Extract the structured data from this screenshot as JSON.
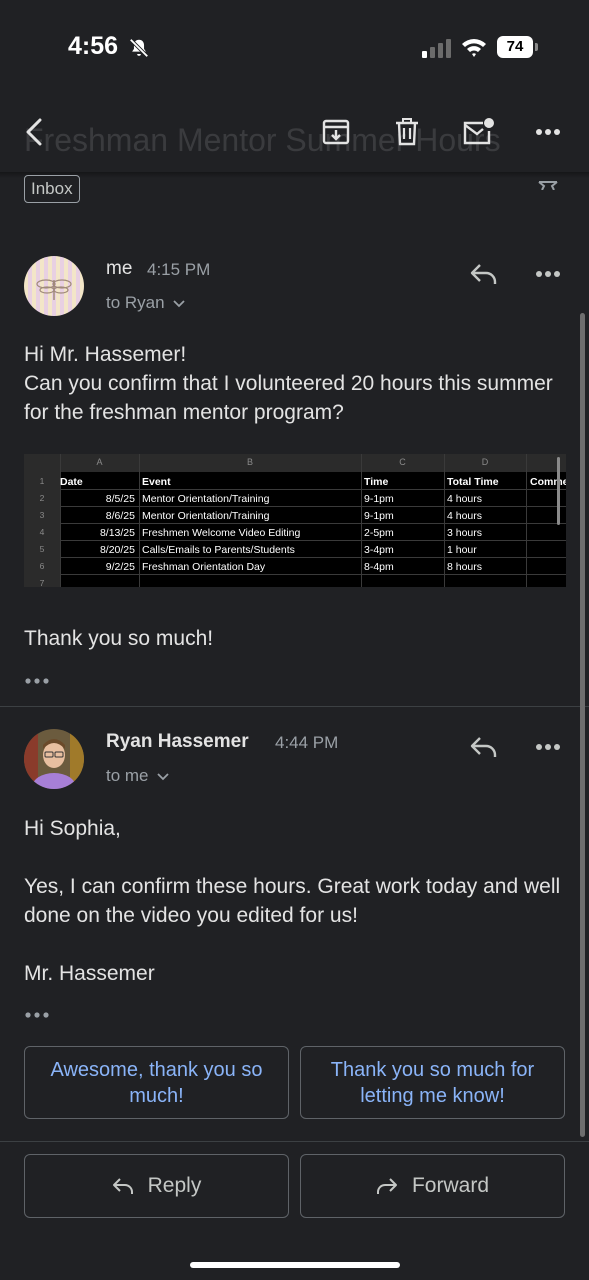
{
  "status_bar": {
    "time": "4:56",
    "battery": "74"
  },
  "toolbar": {
    "subject_behind": "Freshman Mentor Summer Hours",
    "icons": [
      "back-arrow-icon",
      "archive-icon",
      "trash-icon",
      "mark-unread-icon",
      "more-icon"
    ]
  },
  "label_chip": "Inbox",
  "messages": [
    {
      "sender": "me",
      "time": "4:15 PM",
      "to": "to Ryan",
      "body": [
        "Hi Mr. Hassemer!",
        "Can you confirm that I volunteered 20 hours this summer for the freshman mentor program?"
      ],
      "closing": "Thank you so much!",
      "sheet": {
        "columns": [
          "A",
          "B",
          "C",
          "D"
        ],
        "row_numbers": [
          "1",
          "2",
          "3",
          "4",
          "5",
          "6",
          "7"
        ],
        "headers": [
          "Date",
          "Event",
          "Time",
          "Total Time",
          "Comme"
        ],
        "rows": [
          [
            "8/5/25",
            "Mentor Orientation/Training",
            "9-1pm",
            "4 hours"
          ],
          [
            "8/6/25",
            "Mentor Orientation/Training",
            "9-1pm",
            "4 hours"
          ],
          [
            "8/13/25",
            "Freshmen Welcome Video Editing",
            "2-5pm",
            "3 hours"
          ],
          [
            "8/20/25",
            "Calls/Emails to Parents/Students",
            "3-4pm",
            "1 hour"
          ],
          [
            "9/2/25",
            "Freshman Orientation Day",
            "8-4pm",
            "8 hours"
          ]
        ]
      }
    },
    {
      "sender": "Ryan Hassemer",
      "time": "4:44 PM",
      "to": "to me",
      "body": [
        "Hi Sophia,",
        "Yes, I can confirm these hours. Great work today and well done on the video you edited for us!",
        "Mr. Hassemer"
      ]
    }
  ],
  "smart_replies": [
    "Awesome, thank you so much!",
    "Thank you so much for letting me know!"
  ],
  "actions": {
    "reply": "Reply",
    "forward": "Forward"
  }
}
